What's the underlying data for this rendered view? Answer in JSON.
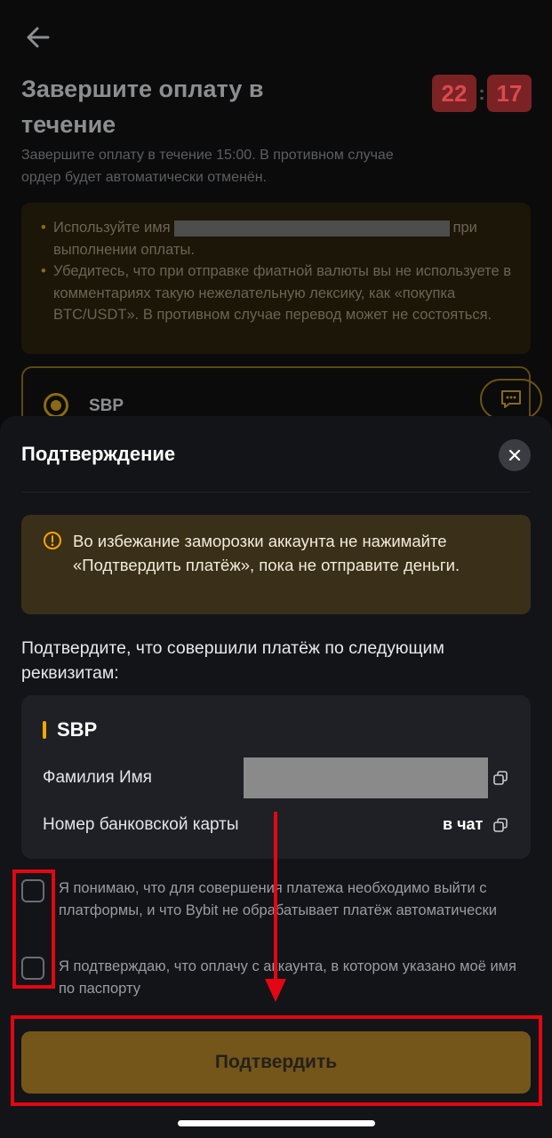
{
  "background": {
    "title": "Завершите оплату в течение",
    "timer": {
      "minutes": "22",
      "separator": ":",
      "seconds": "17"
    },
    "subtitle": "Завершите оплату в течение 15:00. В противном случае ордер будет автоматически отменён.",
    "notice": {
      "item1_prefix": "Используйте имя",
      "item1_suffix": "при выполнении оплаты.",
      "item2": "Убедитесь, что при отправке фиатной валюты вы не используете в комментариях такую нежелательную лексику, как «покупка BTC/USDT». В противном случае перевод может не состояться."
    },
    "payment_method": "SBP"
  },
  "sheet": {
    "title": "Подтверждение",
    "warning": "Во избежание заморозки аккаунта не нажимайте «Подтвердить платёж», пока не отправите деньги.",
    "confirm_text": "Подтвердите, что совершили платёж по следующим реквизитам:",
    "details": {
      "method": "SBP",
      "name_label": "Фамилия Имя",
      "card_label": "Номер банковской карты",
      "card_value": "в чат"
    },
    "checkbox1": "Я понимаю, что для совершения платежа необходимо выйти с платформы, и что Bybit не обрабатывает платёж автоматически",
    "checkbox2": "Я подтверждаю, что оплачу с аккаунта, в котором указано моё имя по паспорту",
    "confirm_button": "Подтвердить"
  },
  "colors": {
    "accent": "#f7a600",
    "annotation": "#e30613",
    "timer_bg": "#7b2225"
  },
  "icons": [
    "back-arrow-icon",
    "chat-icon",
    "close-icon",
    "warning-icon",
    "copy-icon"
  ]
}
